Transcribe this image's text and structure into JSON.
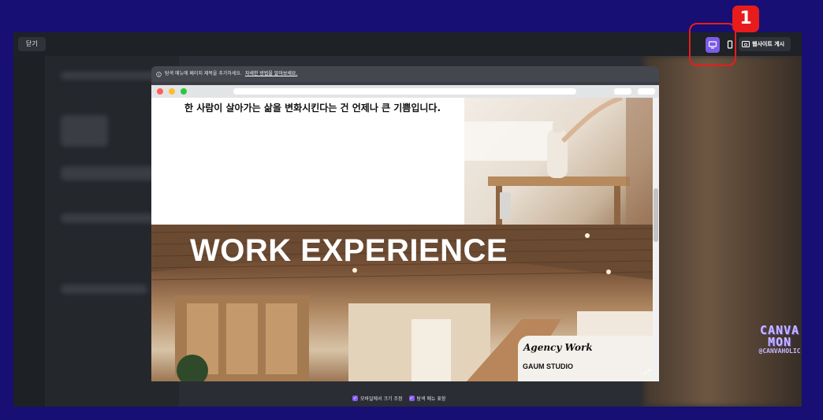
{
  "topbar": {
    "close_label": "닫기",
    "publish_label": "웹사이트 게시",
    "device_toggle": {
      "desktop_icon": "monitor-icon",
      "mobile_icon": "phone-icon",
      "active": "desktop"
    }
  },
  "annotation": {
    "step_number": "1",
    "highlight_color": "#e81c1c"
  },
  "preview": {
    "notice_text": "탐색 메뉴에 페이지 제목을 추가하세요.",
    "notice_link": "자세한 방법을 알아보세요.",
    "tagline": "한 사람이 살아가는 삶을 변화시킨다는 건 언제나 큰 기쁨입니다.",
    "section_title": "WORK EXPERIENCE",
    "card_title": "Agency Work",
    "card_subtitle": "GAUM STUDIO"
  },
  "options": {
    "mobile_resize_label": "모바일에서 크기 조정",
    "nav_menu_label": "탐색 메뉴 표함"
  },
  "watermark": {
    "line1": "CANVA",
    "line2": "MON",
    "handle": "@CANVAHOLIC"
  },
  "colors": {
    "accent": "#7b5ce6",
    "background": "#170f73",
    "checkbox": "#8a5cf6"
  }
}
